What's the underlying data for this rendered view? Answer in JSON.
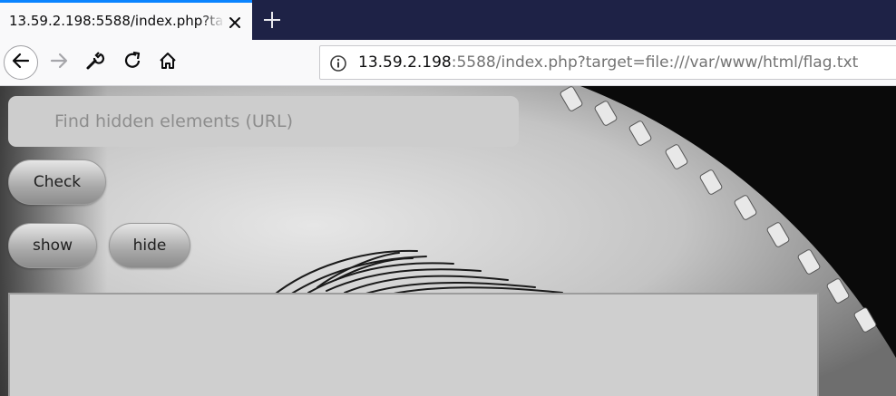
{
  "browser": {
    "tab": {
      "title": "13.59.2.198:5588/index.php?target=file:///var/www/html/flag.txt"
    },
    "url": {
      "host": "13.59.2.198",
      "rest": ":5588/index.php?target=file:///var/www/html/flag.txt"
    },
    "icons": [
      "close-icon",
      "plus-icon",
      "back-arrow-icon",
      "forward-arrow-icon",
      "wrench-icon",
      "reload-icon",
      "home-icon",
      "info-icon"
    ]
  },
  "page": {
    "search": {
      "placeholder": "Find hidden elements (URL)",
      "value": ""
    },
    "check_label": "Check",
    "show_label": "show",
    "hide_label": "hide",
    "result_text": ""
  },
  "colors": {
    "tab_accent": "#0a84ff",
    "tabstrip_bg": "#1e2246",
    "toolbar_bg": "#f9f9fa"
  }
}
